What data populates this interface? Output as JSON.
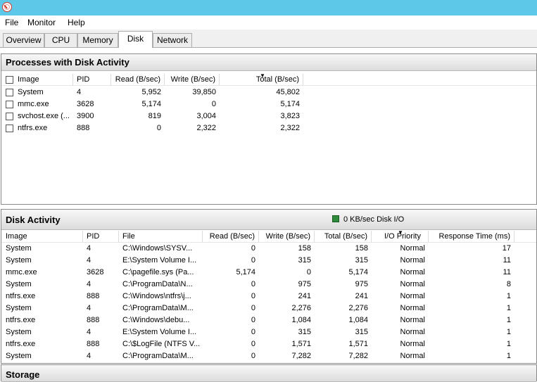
{
  "menu": [
    "File",
    "Monitor",
    "Help"
  ],
  "tabs": [
    {
      "label": "Overview",
      "active": false
    },
    {
      "label": "CPU",
      "active": false
    },
    {
      "label": "Memory",
      "active": false
    },
    {
      "label": "Disk",
      "active": true
    },
    {
      "label": "Network",
      "active": false
    }
  ],
  "processes": {
    "title": "Processes with Disk Activity",
    "columns": [
      "Image",
      "PID",
      "Read (B/sec)",
      "Write (B/sec)",
      "Total (B/sec)"
    ],
    "rows": [
      [
        "System",
        "4",
        "5,952",
        "39,850",
        "45,802"
      ],
      [
        "mmc.exe",
        "3628",
        "5,174",
        "0",
        "5,174"
      ],
      [
        "svchost.exe (...",
        "3900",
        "819",
        "3,004",
        "3,823"
      ],
      [
        "ntfrs.exe",
        "888",
        "0",
        "2,322",
        "2,322"
      ]
    ]
  },
  "disk_activity": {
    "title": "Disk Activity",
    "io_label": "0 KB/sec Disk I/O",
    "columns": [
      "Image",
      "PID",
      "File",
      "Read (B/sec)",
      "Write (B/sec)",
      "Total (B/sec)",
      "I/O Priority",
      "Response Time (ms)"
    ],
    "rows": [
      [
        "System",
        "4",
        "C:\\Windows\\SYSV...",
        "0",
        "158",
        "158",
        "Normal",
        "17"
      ],
      [
        "System",
        "4",
        "E:\\System Volume I...",
        "0",
        "315",
        "315",
        "Normal",
        "11"
      ],
      [
        "mmc.exe",
        "3628",
        "C:\\pagefile.sys (Pa...",
        "5,174",
        "0",
        "5,174",
        "Normal",
        "11"
      ],
      [
        "System",
        "4",
        "C:\\ProgramData\\N...",
        "0",
        "975",
        "975",
        "Normal",
        "8"
      ],
      [
        "ntfrs.exe",
        "888",
        "C:\\Windows\\ntfrs\\j...",
        "0",
        "241",
        "241",
        "Normal",
        "1"
      ],
      [
        "System",
        "4",
        "C:\\ProgramData\\M...",
        "0",
        "2,276",
        "2,276",
        "Normal",
        "1"
      ],
      [
        "ntfrs.exe",
        "888",
        "C:\\Windows\\debu...",
        "0",
        "1,084",
        "1,084",
        "Normal",
        "1"
      ],
      [
        "System",
        "4",
        "E:\\System Volume I...",
        "0",
        "315",
        "315",
        "Normal",
        "1"
      ],
      [
        "ntfrs.exe",
        "888",
        "C:\\$LogFile (NTFS V...",
        "0",
        "1,571",
        "1,571",
        "Normal",
        "1"
      ],
      [
        "System",
        "4",
        "C:\\ProgramData\\M...",
        "0",
        "7,282",
        "7,282",
        "Normal",
        "1"
      ]
    ]
  },
  "storage": {
    "title": "Storage"
  }
}
